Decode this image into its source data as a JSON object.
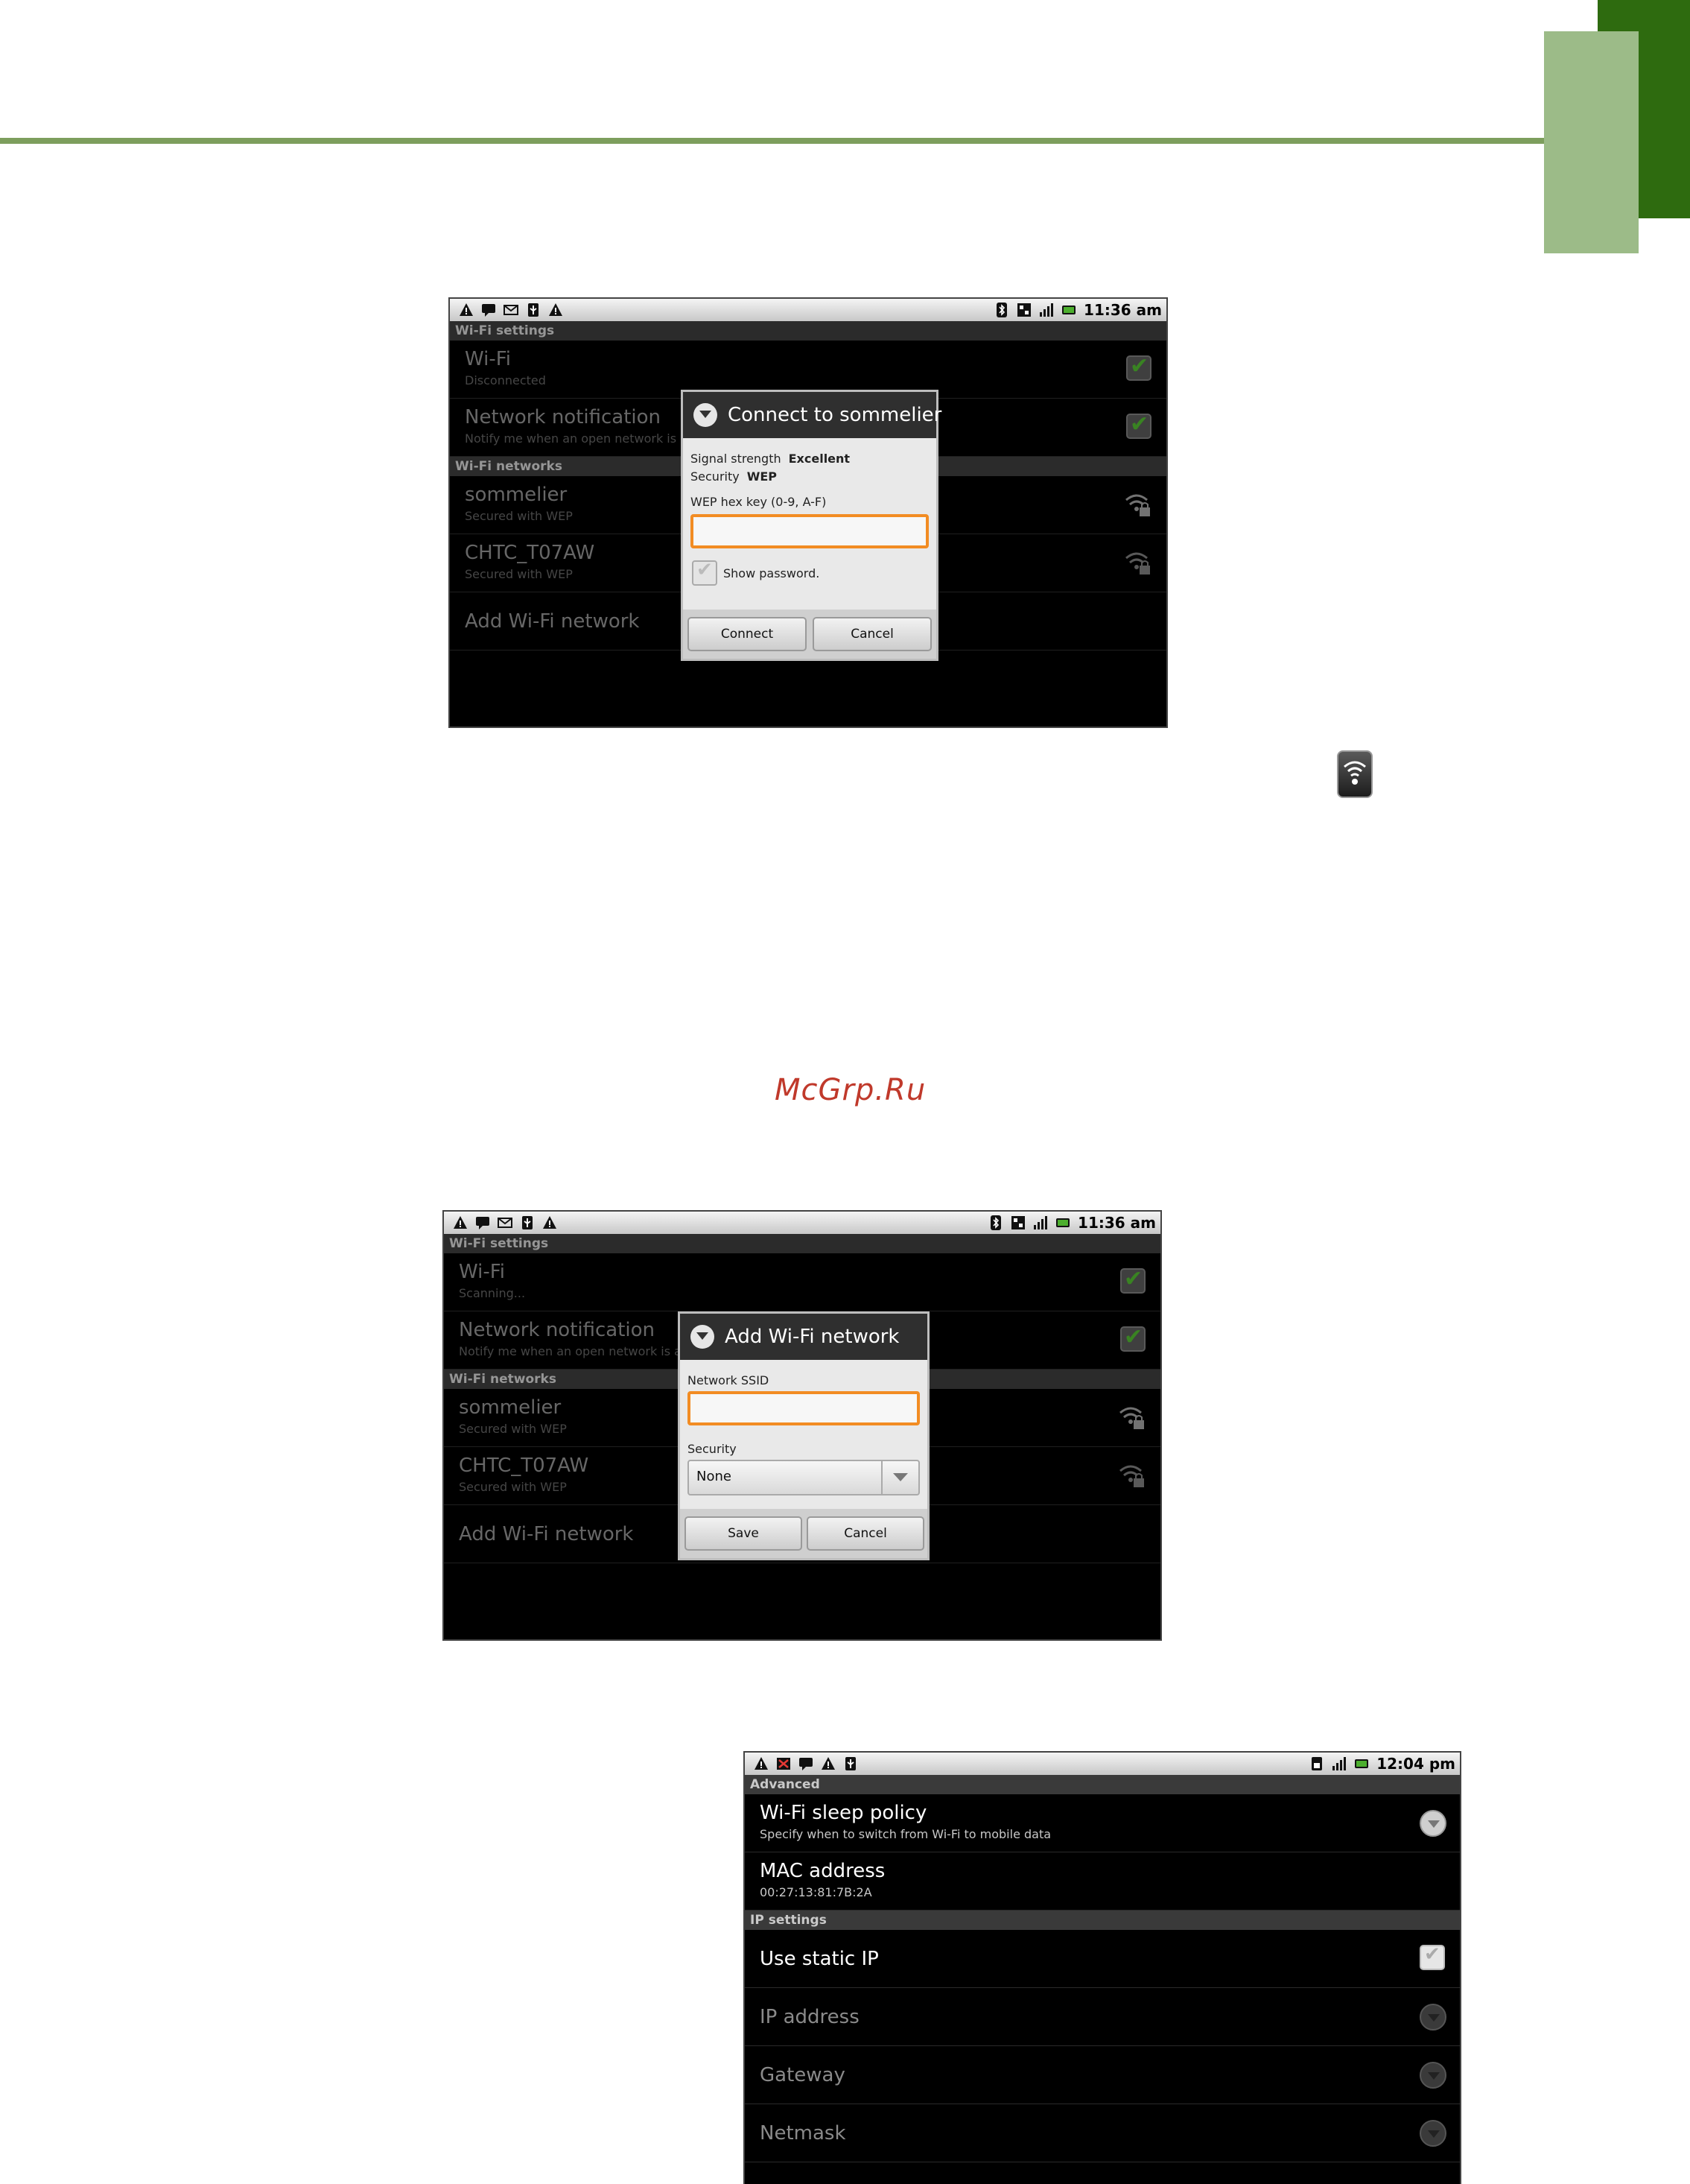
{
  "watermark": "McGrp.Ru",
  "screen1": {
    "status_time": "11:36 am",
    "section_title": "Wi-Fi settings",
    "wifi_title": "Wi-Fi",
    "wifi_status": "Disconnected",
    "notif_title": "Network notification",
    "notif_summary": "Notify me when an open network is a",
    "networks_section": "Wi-Fi networks",
    "networks": [
      {
        "name": "sommelier",
        "security": "Secured with WEP"
      },
      {
        "name": "CHTC_T07AW",
        "security": "Secured with WEP"
      }
    ],
    "add_network": "Add Wi-Fi network",
    "dialog": {
      "title": "Connect to sommelier",
      "signal_label": "Signal strength",
      "signal_value": "Excellent",
      "security_label": "Security",
      "security_value": "WEP",
      "key_label": "WEP hex key (0-9, A-F)",
      "key_value": "",
      "show_password": "Show password.",
      "connect": "Connect",
      "cancel": "Cancel"
    }
  },
  "screen2": {
    "status_time": "11:36 am",
    "section_title": "Wi-Fi settings",
    "wifi_title": "Wi-Fi",
    "wifi_status": "Scanning...",
    "notif_title": "Network notification",
    "notif_summary": "Notify me when an open network is a",
    "networks_section": "Wi-Fi networks",
    "networks": [
      {
        "name": "sommelier",
        "security": "Secured with WEP"
      },
      {
        "name": "CHTC_T07AW",
        "security": "Secured with WEP"
      }
    ],
    "add_network": "Add Wi-Fi network",
    "dialog": {
      "title": "Add Wi-Fi network",
      "ssid_label": "Network SSID",
      "ssid_value": "",
      "security_label": "Security",
      "security_value": "None",
      "save": "Save",
      "cancel": "Cancel"
    }
  },
  "screen3": {
    "status_time": "12:04 pm",
    "section_title": "Advanced",
    "sleep_title": "Wi-Fi sleep policy",
    "sleep_summary": "Specify when to switch from Wi-Fi to mobile data",
    "mac_title": "MAC address",
    "mac_value": "00:27:13:81:7B:2A",
    "ip_section": "IP settings",
    "static_ip": "Use static IP",
    "ip_address": "IP address",
    "gateway": "Gateway",
    "netmask": "Netmask"
  },
  "colors": {
    "accent_green": "#7d9e5d",
    "tab_dark": "#2e6b0f",
    "tab_light": "#9cbb88",
    "field_focus": "#f28c23",
    "watermark": "#c0392b"
  }
}
